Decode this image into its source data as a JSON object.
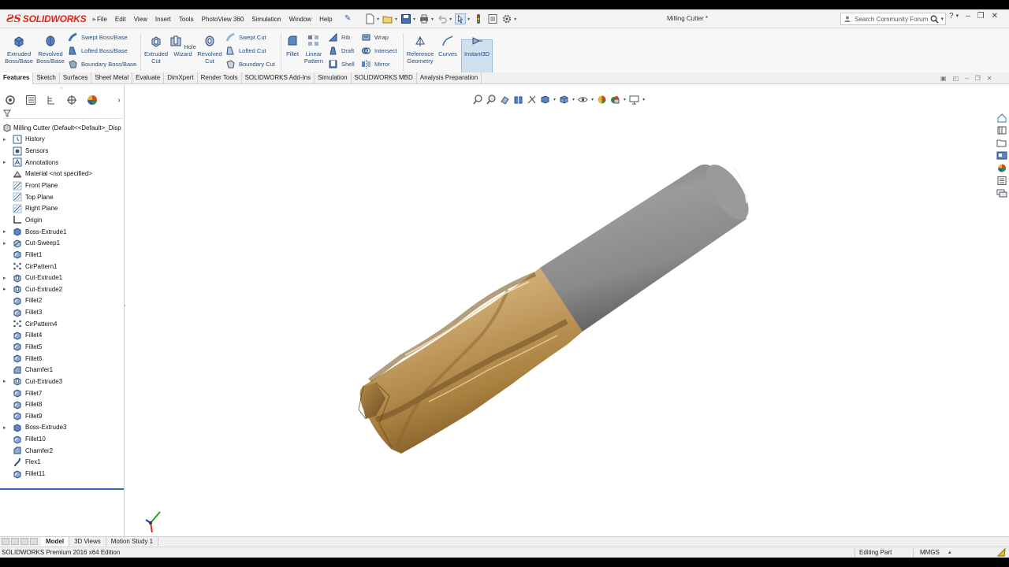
{
  "app": {
    "brand": "SOLIDWORKS",
    "document_title": "Milling Cutter *"
  },
  "menu": [
    "File",
    "Edit",
    "View",
    "Insert",
    "Tools",
    "PhotoView 360",
    "Simulation",
    "Window",
    "Help"
  ],
  "search": {
    "placeholder": "Search Community Forum"
  },
  "commands": {
    "extruded_boss": "Extruded Boss/Base",
    "revolved_boss": "Revolved Boss/Base",
    "swept_boss": "Swept Boss/Base",
    "lofted_boss": "Lofted Boss/Base",
    "boundary_boss": "Boundary Boss/Base",
    "extruded_cut": "Extruded Cut",
    "hole_wizard": "Hole Wizard",
    "revolved_cut": "Revolved Cut",
    "swept_cut": "Swept Cut",
    "lofted_cut": "Lofted Cut",
    "boundary_cut": "Boundary Cut",
    "fillet": "Fillet",
    "linear_pattern": "Linear Pattern",
    "rib": "Rib",
    "draft": "Draft",
    "shell": "Shell",
    "wrap": "Wrap",
    "intersect": "Intersect",
    "mirror": "Mirror",
    "reference_geometry": "Reference Geometry",
    "curves": "Curves",
    "instant3d": "Instant3D"
  },
  "tabs": [
    "Features",
    "Sketch",
    "Surfaces",
    "Sheet Metal",
    "Evaluate",
    "DimXpert",
    "Render Tools",
    "SOLIDWORKS Add-Ins",
    "Simulation",
    "SOLIDWORKS MBD",
    "Analysis Preparation"
  ],
  "tree": {
    "root": "Milling Cutter  (Default<<Default>_Disp",
    "items": [
      {
        "label": "History",
        "icon": "history-icon",
        "expandable": true
      },
      {
        "label": "Sensors",
        "icon": "sensor-icon",
        "expandable": false
      },
      {
        "label": "Annotations",
        "icon": "annotation-icon",
        "expandable": true
      },
      {
        "label": "Material <not specified>",
        "icon": "material-icon",
        "expandable": false
      },
      {
        "label": "Front Plane",
        "icon": "plane-icon",
        "expandable": false
      },
      {
        "label": "Top Plane",
        "icon": "plane-icon",
        "expandable": false
      },
      {
        "label": "Right Plane",
        "icon": "plane-icon",
        "expandable": false
      },
      {
        "label": "Origin",
        "icon": "origin-icon",
        "expandable": false
      },
      {
        "label": "Boss-Extrude1",
        "icon": "extrude-icon",
        "expandable": true
      },
      {
        "label": "Cut-Sweep1",
        "icon": "sweep-icon",
        "expandable": true
      },
      {
        "label": "Fillet1",
        "icon": "fillet-icon",
        "expandable": false
      },
      {
        "label": "CirPattern1",
        "icon": "pattern-icon",
        "expandable": false
      },
      {
        "label": "Cut-Extrude1",
        "icon": "cut-icon",
        "expandable": true
      },
      {
        "label": "Cut-Extrude2",
        "icon": "cut-icon",
        "expandable": true
      },
      {
        "label": "Fillet2",
        "icon": "fillet-icon",
        "expandable": false
      },
      {
        "label": "Fillet3",
        "icon": "fillet-icon",
        "expandable": false
      },
      {
        "label": "CirPattern4",
        "icon": "pattern-icon",
        "expandable": false
      },
      {
        "label": "Fillet4",
        "icon": "fillet-icon",
        "expandable": false
      },
      {
        "label": "Fillet5",
        "icon": "fillet-icon",
        "expandable": false
      },
      {
        "label": "Fillet6",
        "icon": "fillet-icon",
        "expandable": false
      },
      {
        "label": "Chamfer1",
        "icon": "chamfer-icon",
        "expandable": false
      },
      {
        "label": "Cut-Extrude3",
        "icon": "cut-icon",
        "expandable": true
      },
      {
        "label": "Fillet7",
        "icon": "fillet-icon",
        "expandable": false
      },
      {
        "label": "Fillet8",
        "icon": "fillet-icon",
        "expandable": false
      },
      {
        "label": "Fillet9",
        "icon": "fillet-icon",
        "expandable": false
      },
      {
        "label": "Boss-Extrude3",
        "icon": "extrude-icon",
        "expandable": true
      },
      {
        "label": "Fillet10",
        "icon": "fillet-icon",
        "expandable": false
      },
      {
        "label": "Chamfer2",
        "icon": "chamfer-icon",
        "expandable": false
      },
      {
        "label": "Flex1",
        "icon": "flex-icon",
        "expandable": false
      },
      {
        "label": "Fillet11",
        "icon": "fillet-icon",
        "expandable": false
      }
    ]
  },
  "bottom_tabs": [
    "Model",
    "3D Views",
    "Motion Study 1"
  ],
  "status": {
    "edition": "SOLIDWORKS Premium 2016 x64 Edition",
    "mode": "Editing Part",
    "units": "MMGS"
  },
  "colors": {
    "brand_red": "#e2231a",
    "tool_blue": "#2a4d7a",
    "rollback_blue": "#2c6fb3",
    "shank_gray": "#8a8a8a",
    "flute_gold": "#c9a46a"
  }
}
